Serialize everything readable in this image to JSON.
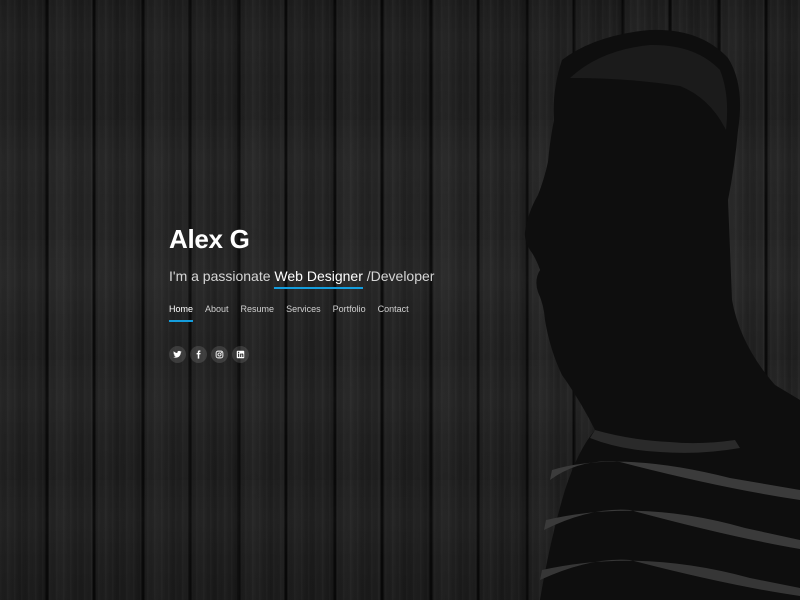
{
  "hero": {
    "name": "Alex G",
    "tagline_prefix": "I'm a passionate ",
    "tagline_typed": "Web Designer",
    "tagline_suffix": " /Developer"
  },
  "nav": {
    "items": [
      {
        "label": "Home",
        "active": true
      },
      {
        "label": "About",
        "active": false
      },
      {
        "label": "Resume",
        "active": false
      },
      {
        "label": "Services",
        "active": false
      },
      {
        "label": "Portfolio",
        "active": false
      },
      {
        "label": "Contact",
        "active": false
      }
    ]
  },
  "social": {
    "links": [
      {
        "icon": "twitter-icon"
      },
      {
        "icon": "facebook-icon"
      },
      {
        "icon": "instagram-icon"
      },
      {
        "icon": "linkedin-icon"
      }
    ]
  },
  "colors": {
    "accent": "#149ddd",
    "text": "#ffffff"
  }
}
